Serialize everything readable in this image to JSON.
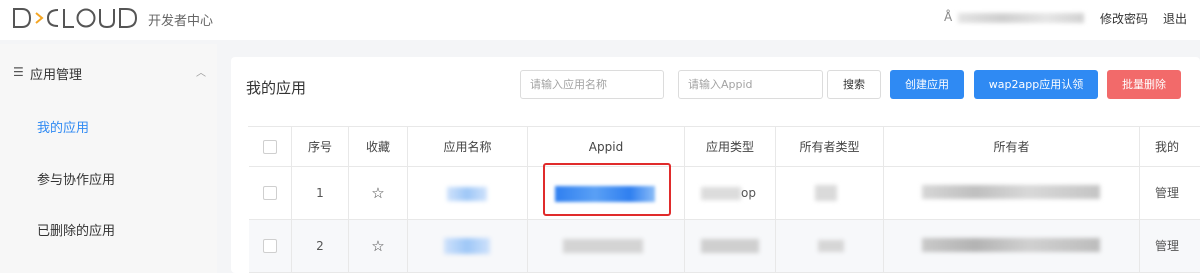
{
  "header": {
    "logo_alt": "DCLOUD",
    "subtitle": "开发者中心",
    "user_icon": "user-icon",
    "change_password": "修改密码",
    "logout": "退出"
  },
  "sidebar": {
    "group_label": "应用管理",
    "items": [
      {
        "label": "我的应用",
        "active": true
      },
      {
        "label": "参与协作应用",
        "active": false
      },
      {
        "label": "已删除的应用",
        "active": false
      }
    ]
  },
  "main": {
    "title": "我的应用",
    "search_name_placeholder": "请输入应用名称",
    "search_appid_placeholder": "请输入Appid",
    "search_button": "搜索",
    "create_button": "创建应用",
    "auth_button": "wap2app应用认领",
    "batch_delete_button": "批量删除"
  },
  "table": {
    "columns": [
      "序号",
      "收藏",
      "应用名称",
      "Appid",
      "应用类型",
      "所有者类型",
      "所有者",
      "我的"
    ],
    "rows": [
      {
        "index": "1",
        "type_suffix": "op",
        "mine": "管理"
      },
      {
        "index": "2",
        "mine": "管理"
      }
    ]
  },
  "colors": {
    "accent": "#2f8af3",
    "danger": "#f26a6a",
    "highlight_border": "#e02b2b"
  }
}
